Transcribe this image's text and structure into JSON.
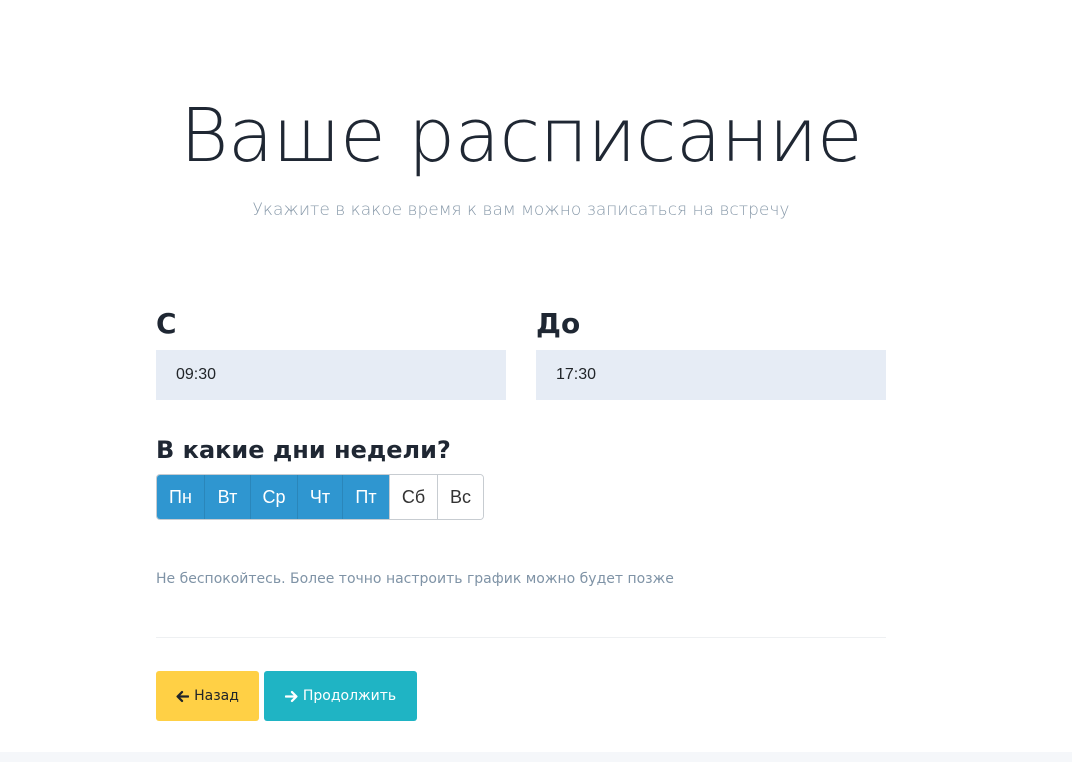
{
  "header": {
    "title": "Ваше расписание",
    "subtitle": "Укажите в какое время к вам можно записаться на встречу"
  },
  "time": {
    "from_label": "С",
    "from_value": "09:30",
    "to_label": "До",
    "to_value": "17:30"
  },
  "days": {
    "heading": "В какие дни недели?",
    "items": [
      {
        "label": "Пн",
        "selected": true
      },
      {
        "label": "Вт",
        "selected": true
      },
      {
        "label": "Ср",
        "selected": true
      },
      {
        "label": "Чт",
        "selected": true
      },
      {
        "label": "Пт",
        "selected": true
      },
      {
        "label": "Сб",
        "selected": false
      },
      {
        "label": "Вс",
        "selected": false
      }
    ]
  },
  "hint": "Не беспокойтесь. Более точно настроить график можно будет позже",
  "actions": {
    "back_label": "Назад",
    "back_icon": "arrow-left-icon",
    "next_label": "Продолжить",
    "next_icon": "arrow-right-icon"
  },
  "colors": {
    "day_selected": "#2f96d0",
    "back_button": "#ffd045",
    "next_button": "#1fb4c4",
    "input_background": "#e6ecf5"
  }
}
